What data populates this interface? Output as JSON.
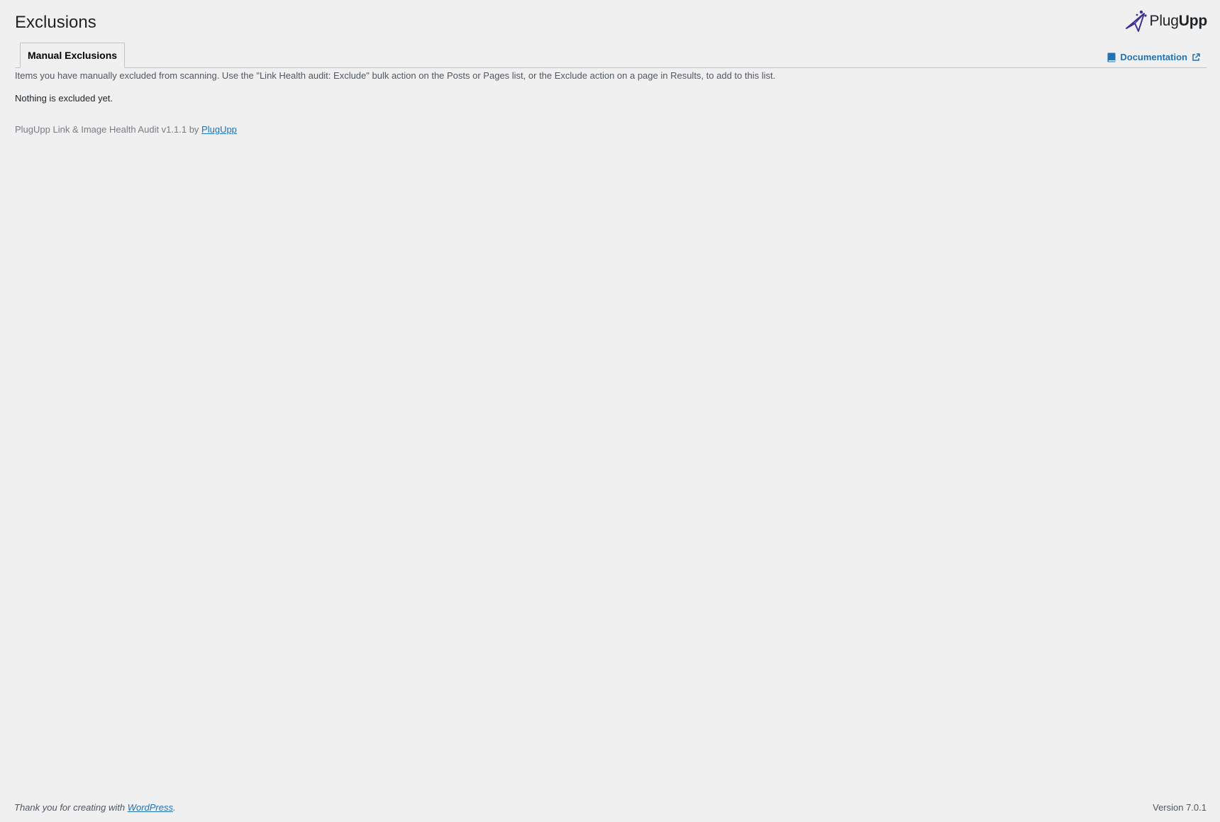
{
  "page": {
    "title": "Exclusions"
  },
  "brand": {
    "name_part1": "Plug",
    "name_part2": "Upp",
    "accent_color": "#3b2f8f"
  },
  "tabs": [
    {
      "label": "Manual Exclusions",
      "active": true
    }
  ],
  "documentation": {
    "label": "Documentation",
    "icon": "book-icon",
    "external_icon": "external-link-icon"
  },
  "content": {
    "intro": "Items you have manually excluded from scanning. Use the \"Link Health audit: Exclude\" bulk action on the Posts or Pages list, or the Exclude action on a page in Results, to add to this list.",
    "empty_message": "Nothing is excluded yet."
  },
  "plugin_footer": {
    "text": "PlugUpp Link & Image Health Audit v1.1.1 by ",
    "link_label": "PlugUpp"
  },
  "wp_footer": {
    "text": "Thank you for creating with ",
    "link_label": "WordPress",
    "suffix": ".",
    "version": "Version 7.0.1"
  },
  "colors": {
    "background": "#f0f0f1",
    "link": "#2271b1",
    "border": "#c3c4c7"
  }
}
